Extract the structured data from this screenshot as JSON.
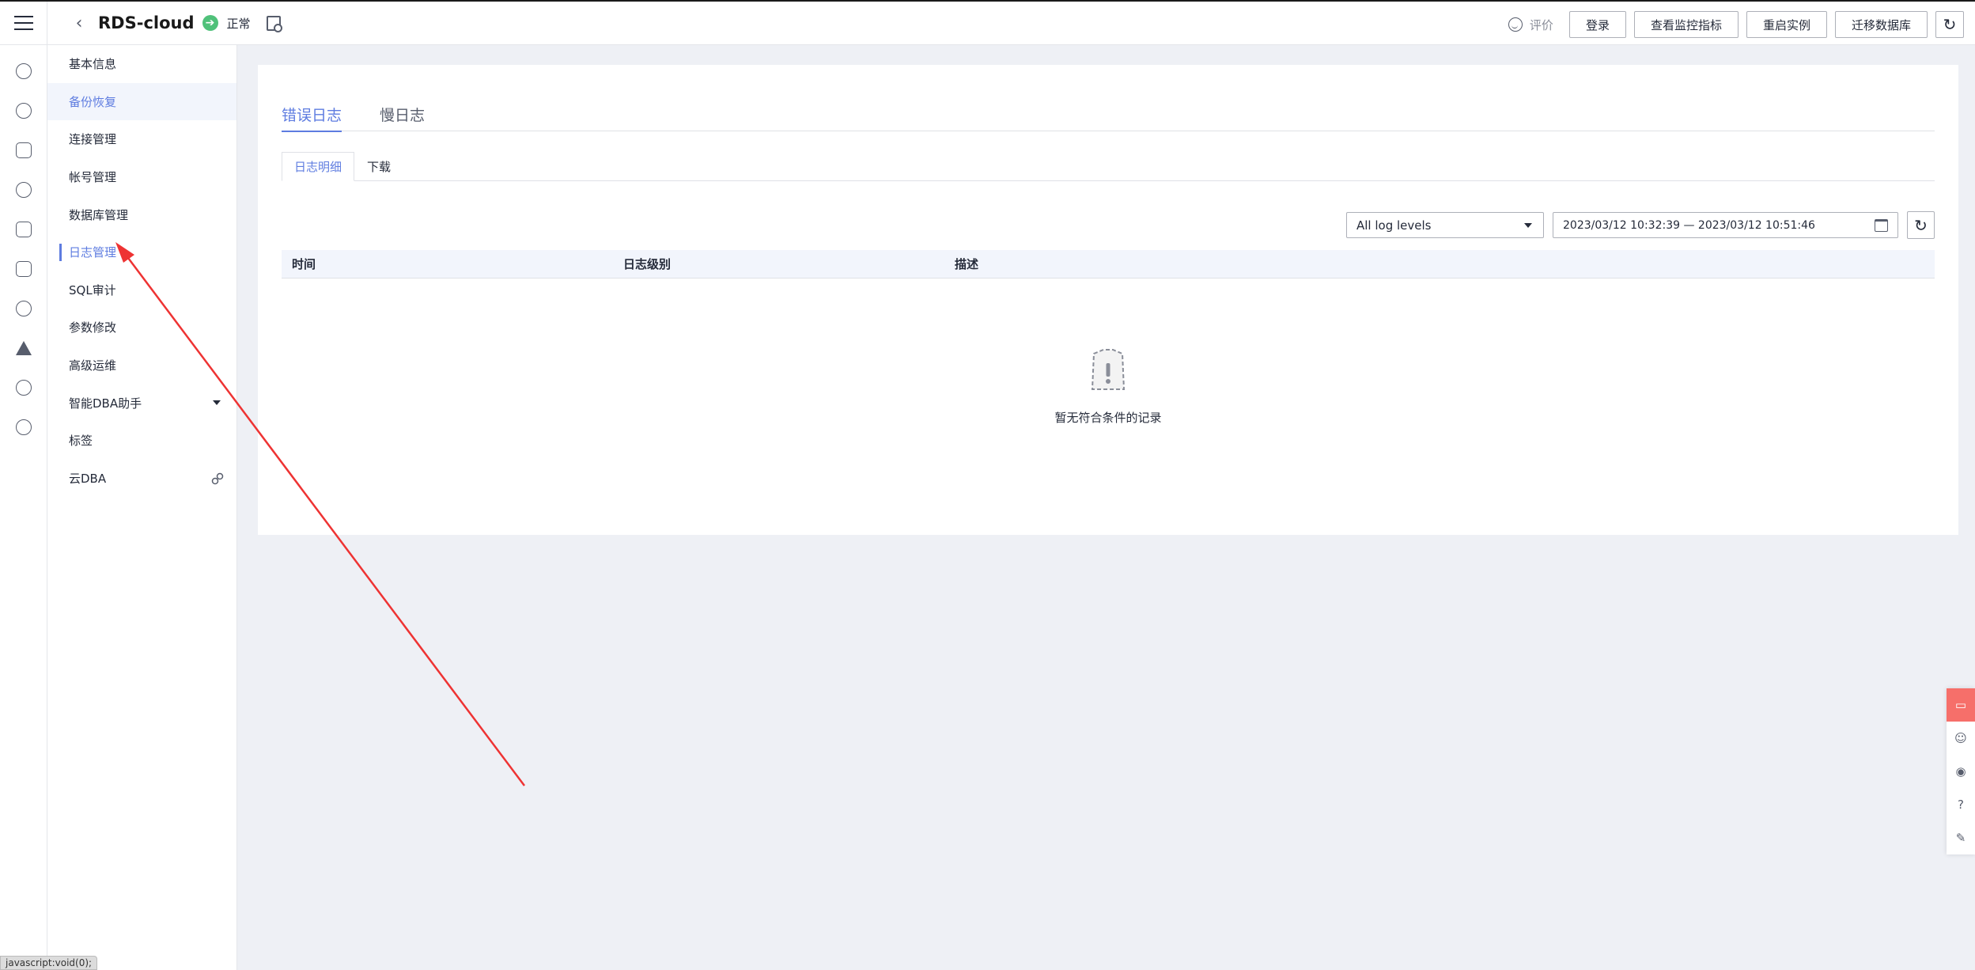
{
  "header": {
    "instance_name": "RDS-cloud",
    "status": "正常",
    "rate_label": "评价",
    "buttons": [
      "登录",
      "查看监控指标",
      "重启实例",
      "迁移数据库"
    ]
  },
  "rail": {
    "icons": [
      "cloud-server-icon",
      "cluster-icon",
      "network-icon",
      "cloud-disk-icon",
      "database-icon",
      "storage-icon",
      "cloud-icon",
      "deploy-icon",
      "globe-icon",
      "ip-icon"
    ]
  },
  "submenu": {
    "items": [
      {
        "label": "基本信息"
      },
      {
        "label": "备份恢复"
      },
      {
        "label": "连接管理"
      },
      {
        "label": "帐号管理"
      },
      {
        "label": "数据库管理"
      },
      {
        "label": "日志管理"
      },
      {
        "label": "SQL审计"
      },
      {
        "label": "参数修改"
      },
      {
        "label": "高级运维"
      },
      {
        "label": "智能DBA助手"
      },
      {
        "label": "标签"
      },
      {
        "label": "云DBA"
      }
    ]
  },
  "main": {
    "tabs": [
      "错误日志",
      "慢日志"
    ],
    "subtabs": [
      "日志明细",
      "下载"
    ],
    "level_select": "All log levels",
    "date_range": "2023/03/12 10:32:39 — 2023/03/12 10:51:46",
    "columns": [
      "时间",
      "日志级别",
      "描述"
    ],
    "empty_text": "暂无符合条件的记录"
  },
  "statusbar": "javascript:void(0);",
  "colors": {
    "accent": "#5e7ce0",
    "status_green": "#50c17a",
    "annotation_red": "#ee3333"
  }
}
